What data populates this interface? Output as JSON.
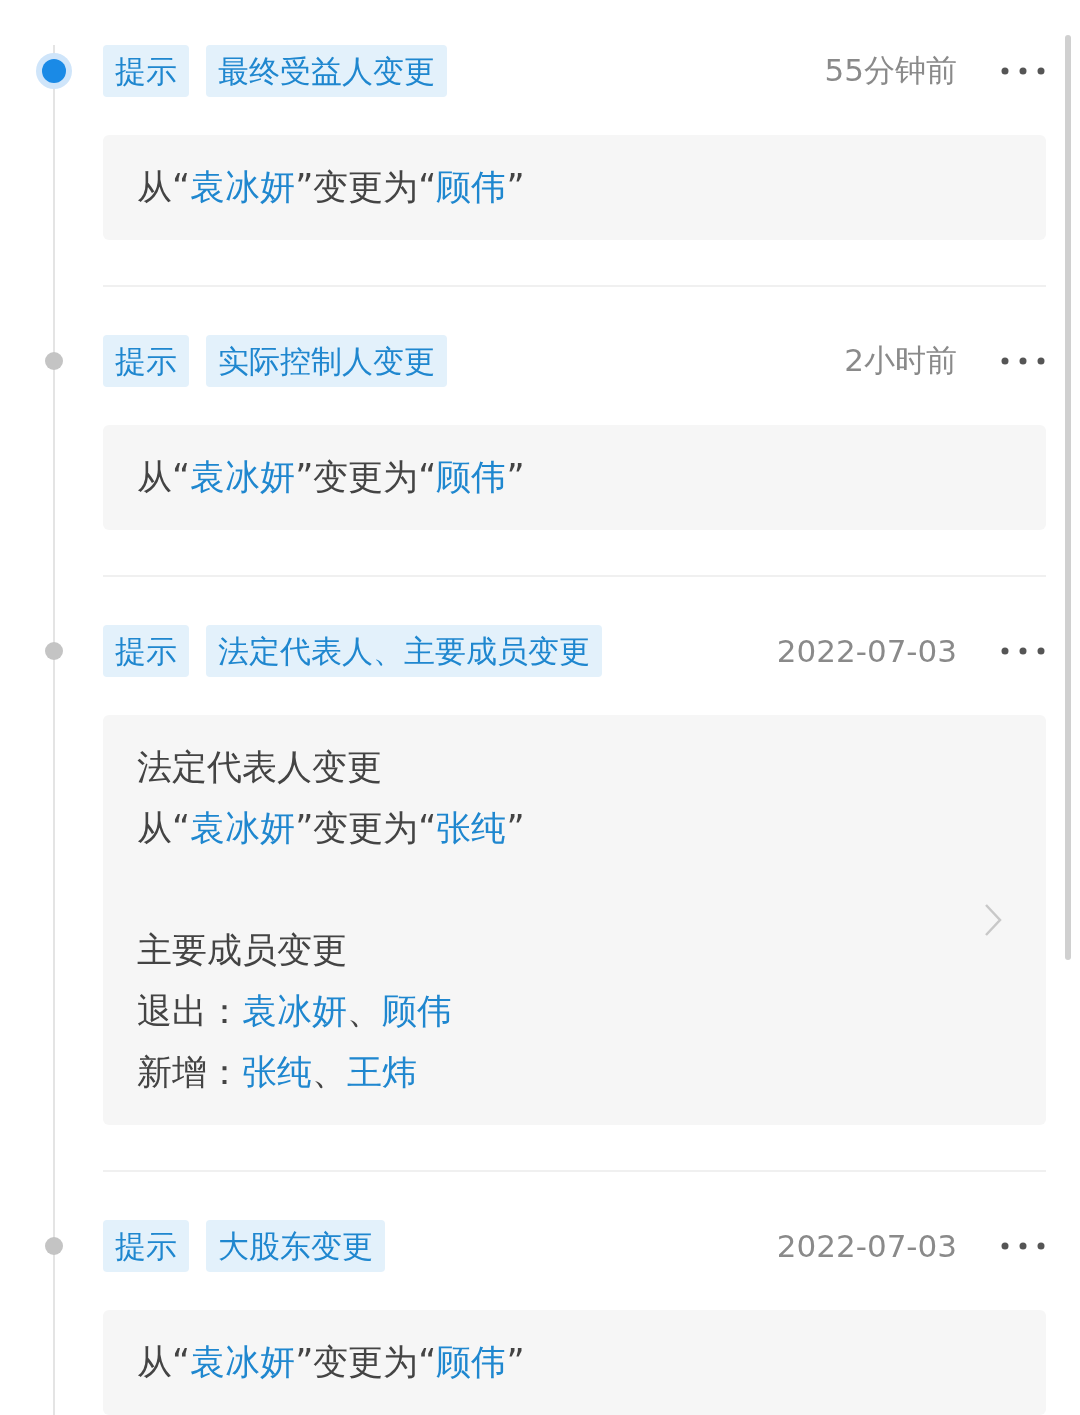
{
  "entries": [
    {
      "active": true,
      "tags": [
        "提示",
        "最终受益人变更"
      ],
      "time": "55分钟前",
      "chevron": false,
      "lines": [
        {
          "kind": "text",
          "parts": [
            {
              "text": "从“",
              "kind": "plain"
            },
            {
              "text": "袁冰妍",
              "kind": "name"
            },
            {
              "text": "”变更为“",
              "kind": "plain"
            },
            {
              "text": "顾伟",
              "kind": "name"
            },
            {
              "text": "”",
              "kind": "plain"
            }
          ]
        }
      ]
    },
    {
      "active": false,
      "tags": [
        "提示",
        "实际控制人变更"
      ],
      "time": "2小时前",
      "chevron": false,
      "lines": [
        {
          "kind": "text",
          "parts": [
            {
              "text": "从“",
              "kind": "plain"
            },
            {
              "text": "袁冰妍",
              "kind": "name"
            },
            {
              "text": "”变更为“",
              "kind": "plain"
            },
            {
              "text": "顾伟",
              "kind": "name"
            },
            {
              "text": "”",
              "kind": "plain"
            }
          ]
        }
      ]
    },
    {
      "active": false,
      "tags": [
        "提示",
        "法定代表人、主要成员变更"
      ],
      "time": "2022-07-03",
      "chevron": true,
      "lines": [
        {
          "kind": "text",
          "parts": [
            {
              "text": "法定代表人变更",
              "kind": "plain"
            }
          ]
        },
        {
          "kind": "text",
          "parts": [
            {
              "text": "从“",
              "kind": "plain"
            },
            {
              "text": "袁冰妍",
              "kind": "name"
            },
            {
              "text": "”变更为“",
              "kind": "plain"
            },
            {
              "text": "张纯",
              "kind": "name"
            },
            {
              "text": "”",
              "kind": "plain"
            }
          ]
        },
        {
          "kind": "gap"
        },
        {
          "kind": "text",
          "parts": [
            {
              "text": "主要成员变更",
              "kind": "plain"
            }
          ]
        },
        {
          "kind": "text",
          "parts": [
            {
              "text": "退出：",
              "kind": "plain"
            },
            {
              "text": "袁冰妍",
              "kind": "name"
            },
            {
              "text": "、",
              "kind": "plain"
            },
            {
              "text": "顾伟",
              "kind": "name"
            }
          ]
        },
        {
          "kind": "text",
          "parts": [
            {
              "text": "新增：",
              "kind": "plain"
            },
            {
              "text": "张纯",
              "kind": "name"
            },
            {
              "text": "、",
              "kind": "plain"
            },
            {
              "text": "王炜",
              "kind": "name"
            }
          ]
        }
      ]
    },
    {
      "active": false,
      "tags": [
        "提示",
        "大股东变更"
      ],
      "time": "2022-07-03",
      "chevron": false,
      "lines": [
        {
          "kind": "text",
          "parts": [
            {
              "text": "从“",
              "kind": "plain"
            },
            {
              "text": "袁冰妍",
              "kind": "name"
            },
            {
              "text": "”变更为“",
              "kind": "plain"
            },
            {
              "text": "顾伟",
              "kind": "name"
            },
            {
              "text": "”",
              "kind": "plain"
            }
          ]
        }
      ]
    }
  ]
}
